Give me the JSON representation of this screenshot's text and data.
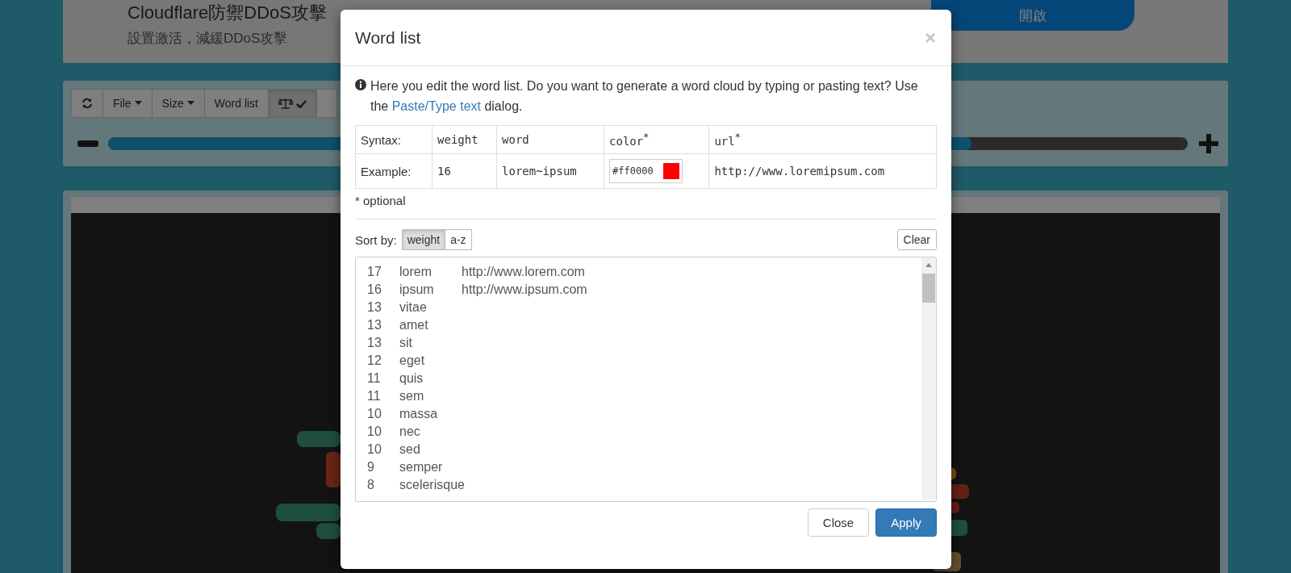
{
  "header": {
    "title": "Cloudflare防禦DDoS攻擊",
    "subtitle": "設置激活，減緩DDoS攻擊",
    "action": "開啟"
  },
  "toolbar": {
    "buttons": [
      {
        "kind": "refresh",
        "pressed": false
      },
      {
        "kind": "menu",
        "label": "File",
        "pressed": false
      },
      {
        "kind": "menu",
        "label": "Size",
        "pressed": false
      },
      {
        "kind": "text",
        "label": "Word list",
        "pressed": false
      },
      {
        "kind": "balance",
        "pressed": true
      },
      {
        "kind": "partial",
        "pressed": false
      }
    ],
    "slider": {
      "level": 0.8
    }
  },
  "modal": {
    "title": "Word list",
    "close": "×",
    "intro": {
      "before": "Here you edit the word list. Do you want to generate a word cloud by typing or pasting text? Use the ",
      "link": "Paste/Type text",
      "after": " dialog."
    },
    "syntax": {
      "label": "Syntax:",
      "weight": "weight",
      "word": "word",
      "color_heading": "color$^{*}$",
      "url": "url$^{*}$"
    },
    "example": {
      "label": "Example:",
      "weight": "16",
      "word": "lorem~ipsum",
      "color_value": "#ff0000",
      "color": "#ff0000",
      "url": "http://www.loremipsum.com"
    },
    "note": "* optional",
    "sort_label": "Sort by:",
    "sort_options": [
      {
        "label": "weight",
        "selected": true
      },
      {
        "label": "a-z",
        "selected": false
      }
    ],
    "clear": "Clear",
    "words": [
      {
        "weight": "17",
        "word": "lorem",
        "url": "http://www.lorem.com"
      },
      {
        "weight": "16",
        "word": "ipsum",
        "url": "http://www.ipsum.com"
      },
      {
        "weight": "13",
        "word": "vitae"
      },
      {
        "weight": "13",
        "word": "amet"
      },
      {
        "weight": "13",
        "word": "sit"
      },
      {
        "weight": "12",
        "word": "eget"
      },
      {
        "weight": "11",
        "word": "quis"
      },
      {
        "weight": "11",
        "word": "sem"
      },
      {
        "weight": "10",
        "word": "massa"
      },
      {
        "weight": "10",
        "word": "nec"
      },
      {
        "weight": "10",
        "word": "sed"
      },
      {
        "weight": "9",
        "word": "semper"
      },
      {
        "weight": "8",
        "word": "scelerisque"
      }
    ],
    "buttons": [
      {
        "label": "Close",
        "kind": "default"
      },
      {
        "label": "Apply",
        "kind": "primary"
      }
    ]
  }
}
